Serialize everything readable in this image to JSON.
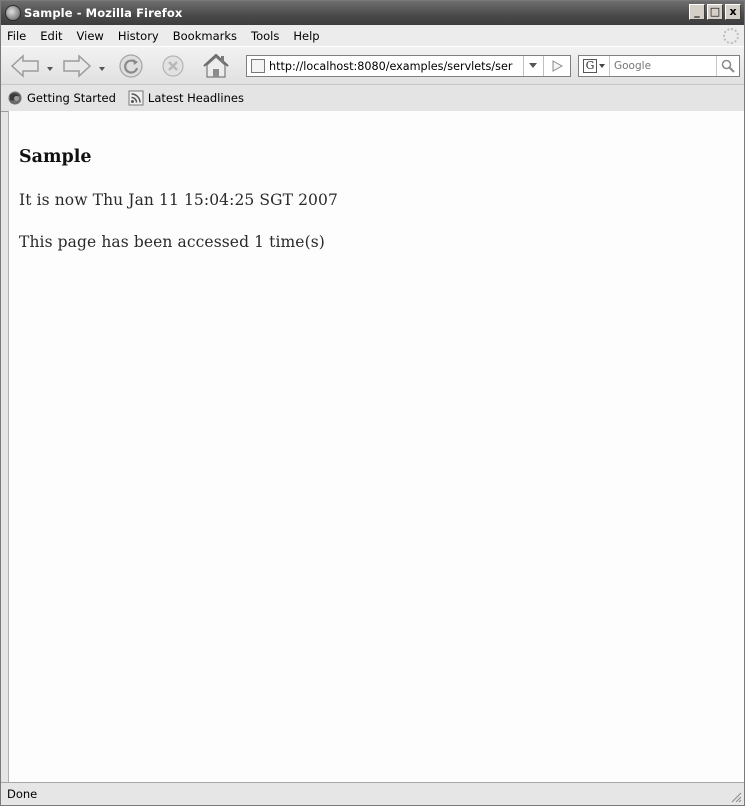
{
  "window": {
    "title": "Sample - Mozilla Firefox",
    "controls": {
      "minimize": "_",
      "maximize": "□",
      "close": "x"
    }
  },
  "menubar": {
    "items": [
      "File",
      "Edit",
      "View",
      "History",
      "Bookmarks",
      "Tools",
      "Help"
    ]
  },
  "navigation": {
    "icons": [
      "back-arrow-icon",
      "forward-arrow-icon",
      "reload-icon",
      "stop-icon",
      "home-icon"
    ],
    "url": "http://localhost:8080/examples/servlets/ser",
    "search_placeholder": "Google"
  },
  "bookmarks": {
    "items": [
      {
        "label": "Getting Started",
        "icon": "firefox-icon"
      },
      {
        "label": "Latest Headlines",
        "icon": "rss-feed-icon"
      }
    ]
  },
  "page": {
    "heading": "Sample",
    "lines": [
      "It is now Thu Jan 11 15:04:25 SGT 2007",
      "This page has been accessed 1 time(s)"
    ]
  },
  "status": {
    "text": "Done"
  }
}
